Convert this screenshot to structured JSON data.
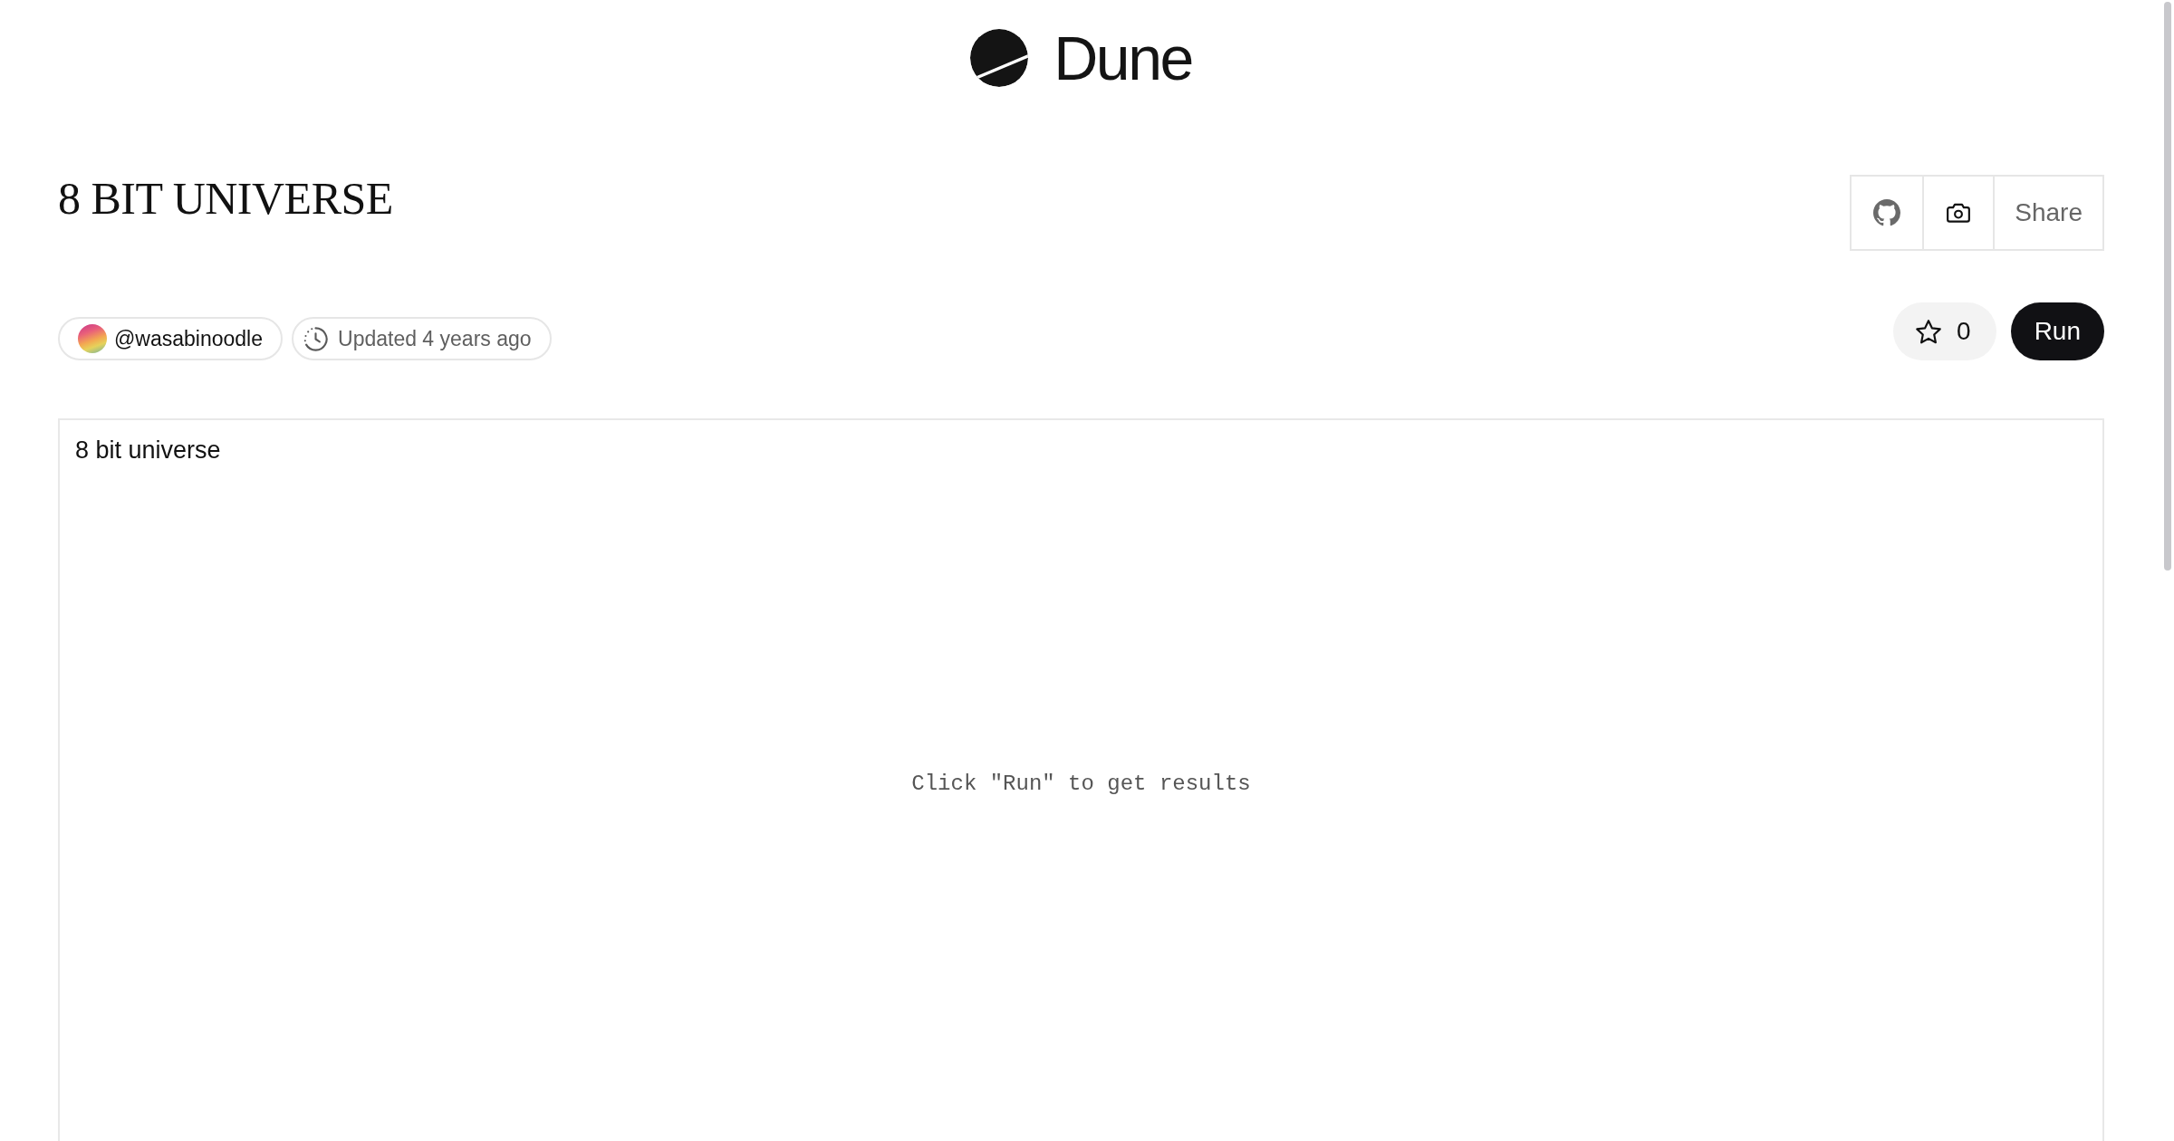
{
  "header": {
    "logo_text": "Dune"
  },
  "dashboard": {
    "title": "8 BIT UNIVERSE",
    "toolbar": {
      "share_label": "Share"
    },
    "author": "@wasabinoodle",
    "updated": "Updated 4 years ago",
    "favorites": {
      "count": "0",
      "starred": false
    },
    "run_label": "Run"
  },
  "result_panel": {
    "title": "8 bit universe",
    "message": "Click \"Run\" to get results"
  }
}
